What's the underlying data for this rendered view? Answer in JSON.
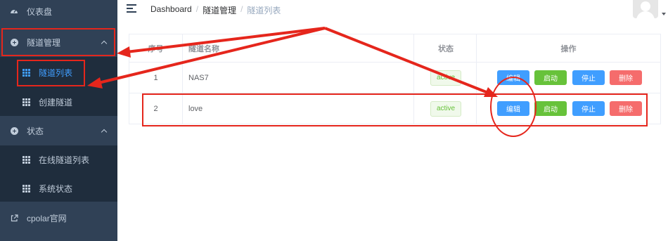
{
  "sidebar": {
    "items": [
      {
        "label": "仪表盘",
        "icon": "dashboard-icon"
      },
      {
        "label": "隧道管理",
        "icon": "plus-circle-icon"
      },
      {
        "label": "隧道列表",
        "icon": "grid-icon",
        "active": true
      },
      {
        "label": "创建隧道",
        "icon": "grid-icon"
      },
      {
        "label": "状态",
        "icon": "plus-circle-icon"
      },
      {
        "label": "在线隧道列表",
        "icon": "grid-icon"
      },
      {
        "label": "系统状态",
        "icon": "grid-icon"
      },
      {
        "label": "cpolar官网",
        "icon": "external-link-icon"
      }
    ]
  },
  "header": {
    "breadcrumb": [
      "Dashboard",
      "隧道管理",
      "隧道列表"
    ],
    "separator": "/"
  },
  "table": {
    "columns": [
      "序号",
      "隧道名称",
      "状态",
      "操作"
    ],
    "rows": [
      {
        "index": "1",
        "name": "NAS7",
        "status": "active"
      },
      {
        "index": "2",
        "name": "love",
        "status": "active"
      }
    ],
    "actions": {
      "edit": "编辑",
      "start": "启动",
      "stop": "停止",
      "delete": "删除"
    }
  },
  "colors": {
    "sidebar_bg": "#304156",
    "submenu_bg": "#1f2d3d",
    "primary": "#409eff",
    "success": "#67c23a",
    "danger": "#f56c6c",
    "annotation": "#e5261c"
  }
}
